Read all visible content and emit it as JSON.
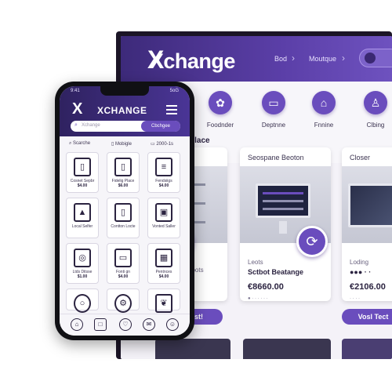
{
  "desktop": {
    "brand": {
      "x": "X",
      "rest": "Xchange"
    },
    "breadcrumbs": [
      "Bod",
      "Moutque"
    ],
    "categories": [
      {
        "label": "Foodnder",
        "icon": "food-icon"
      },
      {
        "label": "Deptnne",
        "icon": "devices-icon"
      },
      {
        "label": "Fnnine",
        "icon": "furniture-icon"
      },
      {
        "label": "Clbing",
        "icon": "clothing-icon"
      }
    ],
    "section_title": "place",
    "cards": [
      {
        "title": "",
        "sub": "Loots",
        "name": "",
        "price": "",
        "meta": "",
        "button": "Boonst!"
      },
      {
        "title": "Seospane Beoton",
        "sub": "Leots",
        "name": "Sctbot Beatange",
        "price": "€8660.00",
        "meta": "● · · · · · ·",
        "button": ""
      },
      {
        "title": "Closer",
        "sub": "Loding",
        "name": "●●● · ·",
        "price": "€2106.00",
        "meta": "· · · ·",
        "button": "Vosl Tect"
      }
    ]
  },
  "phone": {
    "status_left": "9:41",
    "status_right": "5oG",
    "brand_x": "X",
    "brand": "XCHANGE",
    "search_placeholder": "Xchange",
    "search_button": "Cbchgee",
    "tabs": [
      "Scarche",
      "Mobigle",
      "2000-1s"
    ],
    "tiles": [
      {
        "icon": "phone-icon",
        "glyph": "▯",
        "name": "Cosnet Sepbr",
        "price": "$4.00"
      },
      {
        "icon": "tablet-icon",
        "glyph": "▯",
        "name": "Fidelig Place",
        "price": "$6.00"
      },
      {
        "icon": "book-icon",
        "glyph": "≡",
        "name": "Fendsiigs",
        "price": "$4.00"
      },
      {
        "icon": "car-icon",
        "glyph": "▲",
        "name": "Local Selfer",
        "price": ""
      },
      {
        "icon": "phone-icon",
        "glyph": "▯",
        "name": "Contton Locte",
        "price": ""
      },
      {
        "icon": "truck-icon",
        "glyph": "▣",
        "name": "Vonted Saller",
        "price": ""
      },
      {
        "icon": "camera-icon",
        "glyph": "◎",
        "name": "Ltds Ditsse",
        "price": "$1.00"
      },
      {
        "icon": "printer-icon",
        "glyph": "▭",
        "name": "Fonti gn",
        "price": "$4.00"
      },
      {
        "icon": "frame-icon",
        "glyph": "▦",
        "name": "Pentnces",
        "price": "$4.00"
      },
      {
        "icon": "watch-icon",
        "glyph": "○",
        "name": "",
        "price": ""
      },
      {
        "icon": "gear-icon",
        "glyph": "⚙",
        "name": "",
        "price": ""
      },
      {
        "icon": "plant-icon",
        "glyph": "❦",
        "name": "",
        "price": ""
      }
    ],
    "nav": [
      {
        "icon": "home-icon",
        "glyph": "⌂"
      },
      {
        "icon": "bag-icon",
        "glyph": "□"
      },
      {
        "icon": "heart-icon",
        "glyph": "♡"
      },
      {
        "icon": "chat-icon",
        "glyph": "✉"
      },
      {
        "icon": "profile-icon",
        "glyph": "☺"
      }
    ]
  },
  "colors": {
    "brand": "#5b3fa8",
    "accent": "#6a4dbd",
    "dark": "#2f2260"
  }
}
